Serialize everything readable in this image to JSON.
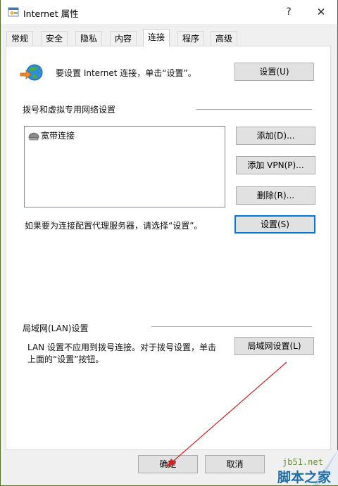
{
  "window": {
    "title": "Internet 属性",
    "help_glyph": "?",
    "close_glyph": "✕"
  },
  "tabs": [
    {
      "label": "常规"
    },
    {
      "label": "安全"
    },
    {
      "label": "隐私"
    },
    {
      "label": "内容"
    },
    {
      "label": "连接",
      "active": true
    },
    {
      "label": "程序"
    },
    {
      "label": "高级"
    }
  ],
  "setup": {
    "text": "要设置 Internet 连接，单击“设置”。",
    "button": "设置(U)",
    "icon": "internet-globe-icon"
  },
  "dialup": {
    "section_title": "拨号和虚拟专用网络设置",
    "items": [
      {
        "label": "宽带连接",
        "icon": "dialup-connection-icon"
      }
    ],
    "add_button": "添加(D)...",
    "add_vpn_button": "添加 VPN(P)...",
    "remove_button": "删除(R)...",
    "proxy_text": "如果要为连接配置代理服务器，请选择“设置”。",
    "settings_button": "设置(S)"
  },
  "lan": {
    "section_title": "局域网(LAN)设置",
    "text_line1": "LAN 设置不应用到拨号连接。对于拨号设置，单击",
    "text_line2": "上面的“设置”按钮。",
    "button": "局域网设置(L)"
  },
  "footer": {
    "ok_button": "确定",
    "cancel_button": "取消"
  },
  "watermark": {
    "site": "jb51.net",
    "name": "脚本之家"
  },
  "colors": {
    "accent": "#0078d7",
    "button_face": "#e1e1e1",
    "annotation_arrow": "#d42020"
  }
}
